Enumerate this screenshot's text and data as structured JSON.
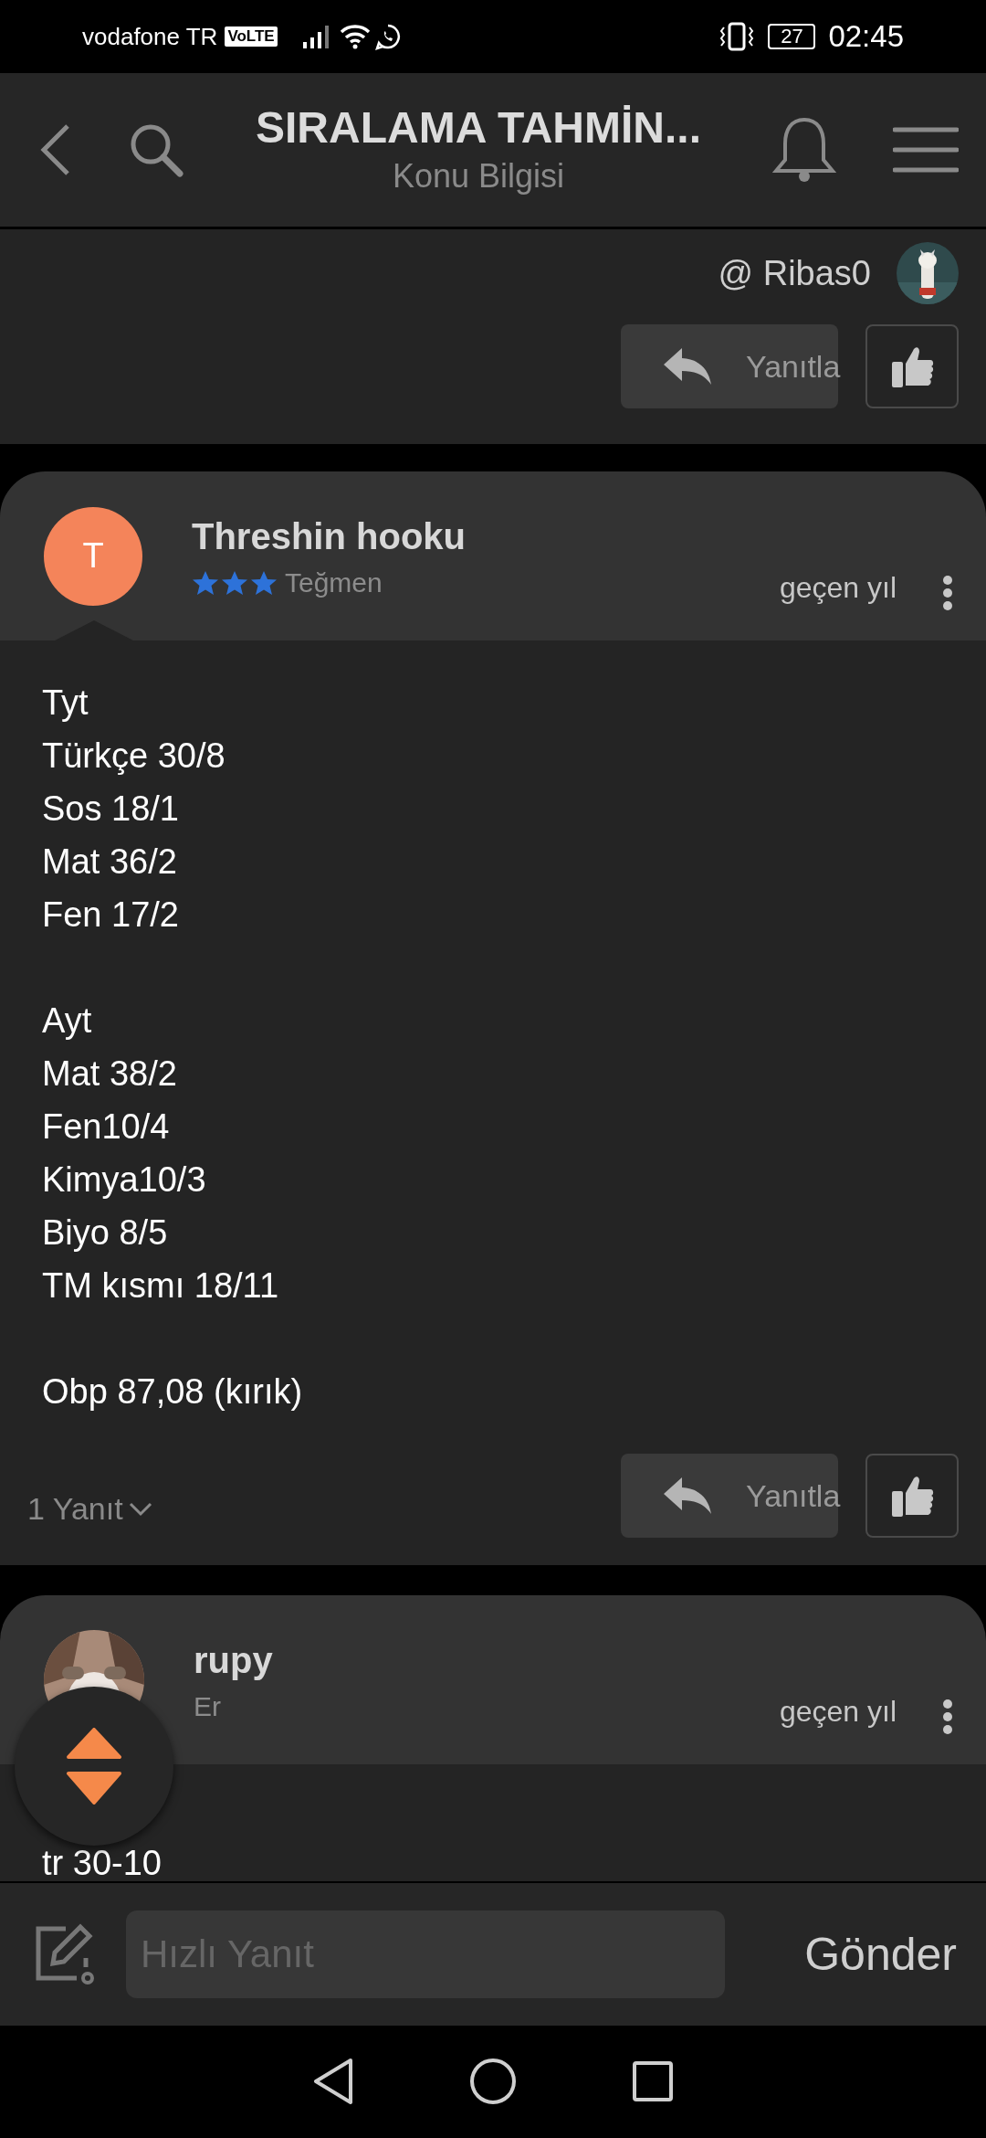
{
  "status_bar": {
    "carrier": "vodafone TR",
    "network_badge": "VoLTE",
    "battery": "27",
    "time": "02:45"
  },
  "header": {
    "title": "SIRALAMA TAHMİN...",
    "subtitle": "Konu Bilgisi"
  },
  "previous_post": {
    "mention": "@ Ribas0",
    "reply_button": "Yanıtla"
  },
  "posts": [
    {
      "kind": "letter",
      "initial": "T",
      "author": "Threshin hooku",
      "stars": 3,
      "rank": "Teğmen",
      "time": "geçen yıl",
      "paragraphs": [
        [
          "Tyt",
          "Türkçe 30/8",
          "Sos 18/1",
          "Mat 36/2",
          "Fen 17/2"
        ],
        [
          "Ayt",
          "Mat 38/2",
          "Fen10/4",
          "Kimya10/3",
          "Biyo 8/5",
          "TM kısmı 18/11"
        ],
        [
          "Obp 87,08 (kırık)"
        ]
      ],
      "replies": "1 Yanıt",
      "reply_button": "Yanıtla"
    },
    {
      "kind": "picture",
      "author": "rupy",
      "rank": "Er",
      "time": "geçen yıl",
      "paragraphs": [
        [
          "tr 30-10"
        ]
      ]
    }
  ],
  "quick_reply": {
    "placeholder": "Hızlı Yanıt",
    "send": "Gönder"
  }
}
